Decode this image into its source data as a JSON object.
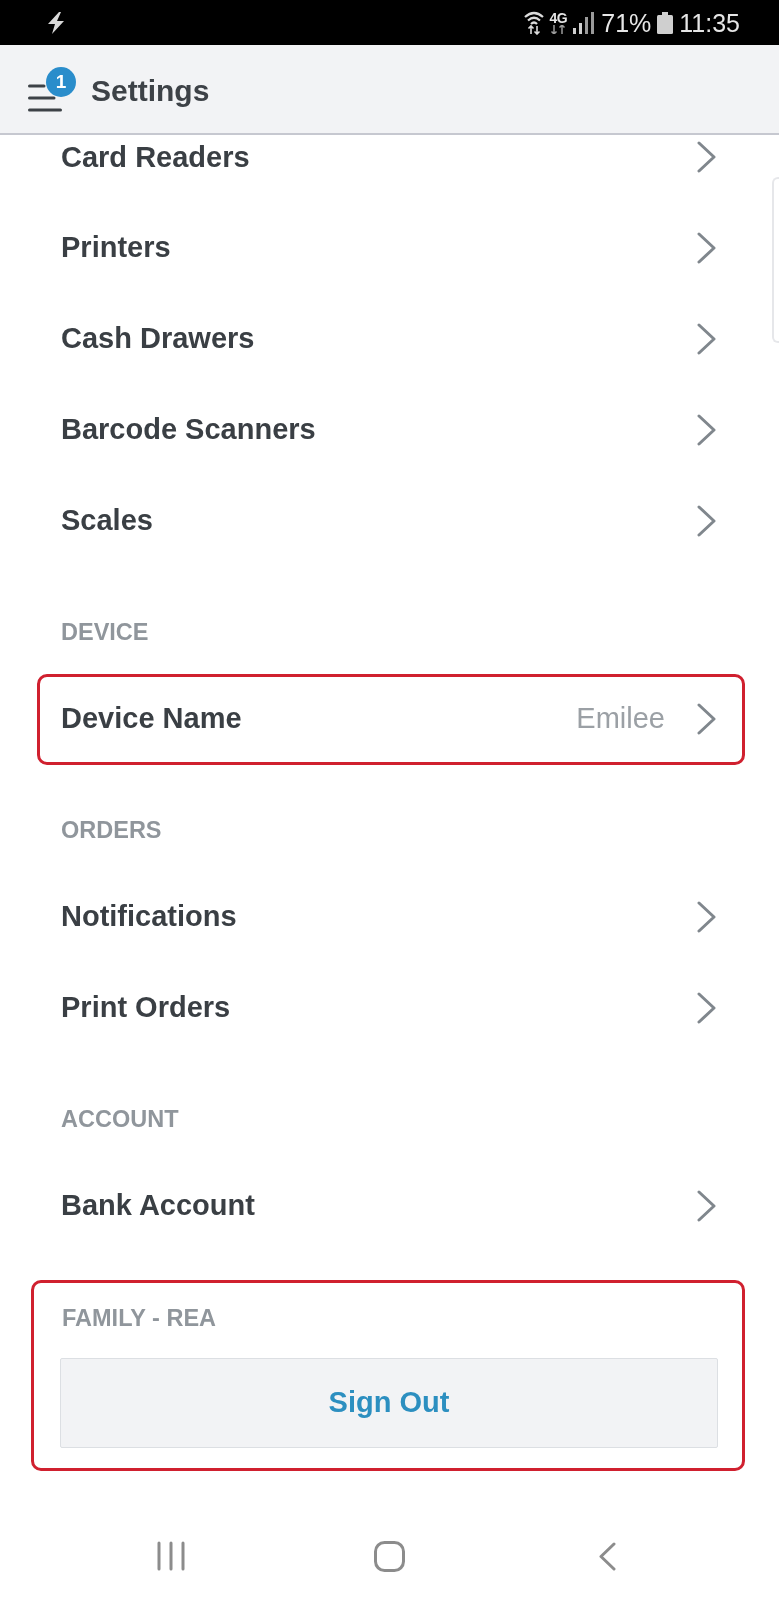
{
  "status_bar": {
    "network": "4G",
    "battery": "71%",
    "time": "11:35"
  },
  "header": {
    "badge": "1",
    "title": "Settings"
  },
  "sections": [
    {
      "items": [
        {
          "label": "Card Readers",
          "highlighted": false
        },
        {
          "label": "Printers",
          "highlighted": false
        },
        {
          "label": "Cash Drawers",
          "highlighted": false
        },
        {
          "label": "Barcode Scanners",
          "highlighted": false
        },
        {
          "label": "Scales",
          "highlighted": false
        }
      ]
    },
    {
      "header": "DEVICE",
      "items": [
        {
          "label": "Device Name",
          "value": "Emilee",
          "highlighted": true
        }
      ]
    },
    {
      "header": "ORDERS",
      "items": [
        {
          "label": "Notifications",
          "highlighted": false
        },
        {
          "label": "Print Orders",
          "highlighted": false
        }
      ]
    },
    {
      "header": "ACCOUNT",
      "items": [
        {
          "label": "Bank Account",
          "highlighted": false
        }
      ]
    }
  ],
  "signout_section": {
    "header": "FAMILY - REA",
    "button": "Sign Out",
    "highlighted": true
  }
}
